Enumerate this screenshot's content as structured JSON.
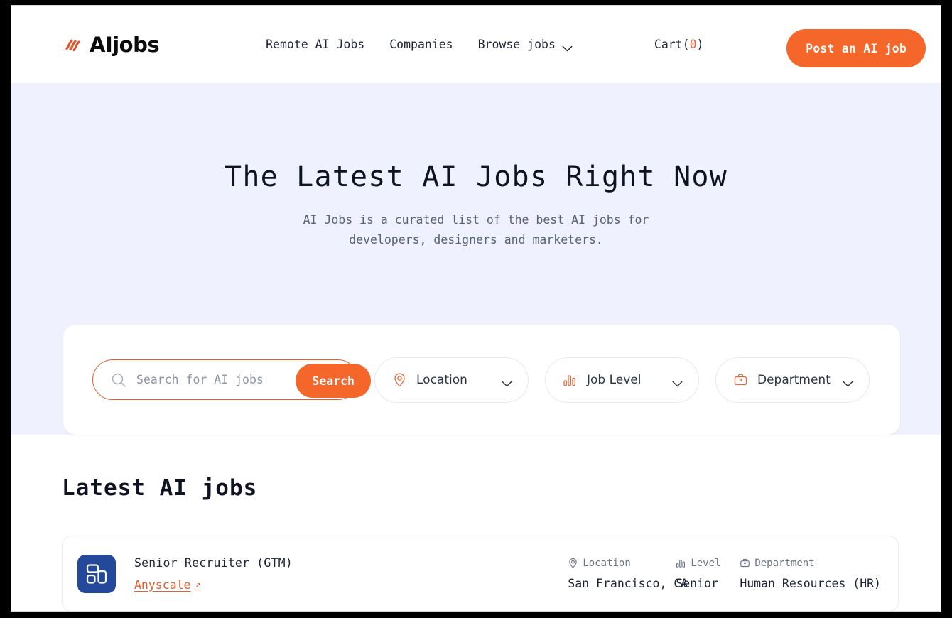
{
  "brand": {
    "name": "AIjobs",
    "logo_icon": "aijobs-waves-icon",
    "accent_color": "#f4662a",
    "hero_bg_color": "#eff1fe"
  },
  "header": {
    "nav": [
      {
        "label": "Remote AI Jobs",
        "icon": null
      },
      {
        "label": "Companies",
        "icon": null
      },
      {
        "label": "Browse jobs",
        "icon": "chevron-down-icon"
      }
    ],
    "cart": {
      "label": "Cart(",
      "count": "0",
      "suffix": ")"
    },
    "post_button": "Post an AI job"
  },
  "hero": {
    "title": "The Latest AI Jobs Right Now",
    "subtitle_line1": "AI Jobs is a curated list of the best AI jobs for",
    "subtitle_line2": "developers, designers and marketers."
  },
  "search": {
    "placeholder": "Search for AI jobs",
    "value": "",
    "icon": "search-icon",
    "button_label": "Search",
    "filters": [
      {
        "label": "Location",
        "icon": "map-pin-icon",
        "chevron": "chevron-down-icon"
      },
      {
        "label": "Job Level",
        "icon": "bar-chart-icon",
        "chevron": "chevron-down-icon"
      },
      {
        "label": "Department",
        "icon": "briefcase-icon",
        "chevron": "chevron-down-icon"
      }
    ]
  },
  "jobs": {
    "section_title": "Latest AI jobs",
    "meta_headers": {
      "location": "Location",
      "level": "Level",
      "department": "Department"
    },
    "list": [
      {
        "title": "Senior Recruiter (GTM)",
        "company": "Anyscale",
        "company_link_icon": "arrow-up-right-icon",
        "logo_icon": "anyscale-logo-icon",
        "logo_color": "#24499a",
        "location": "San Francisco, CA",
        "level": "Senior",
        "department": "Human Resources (HR)"
      }
    ]
  }
}
